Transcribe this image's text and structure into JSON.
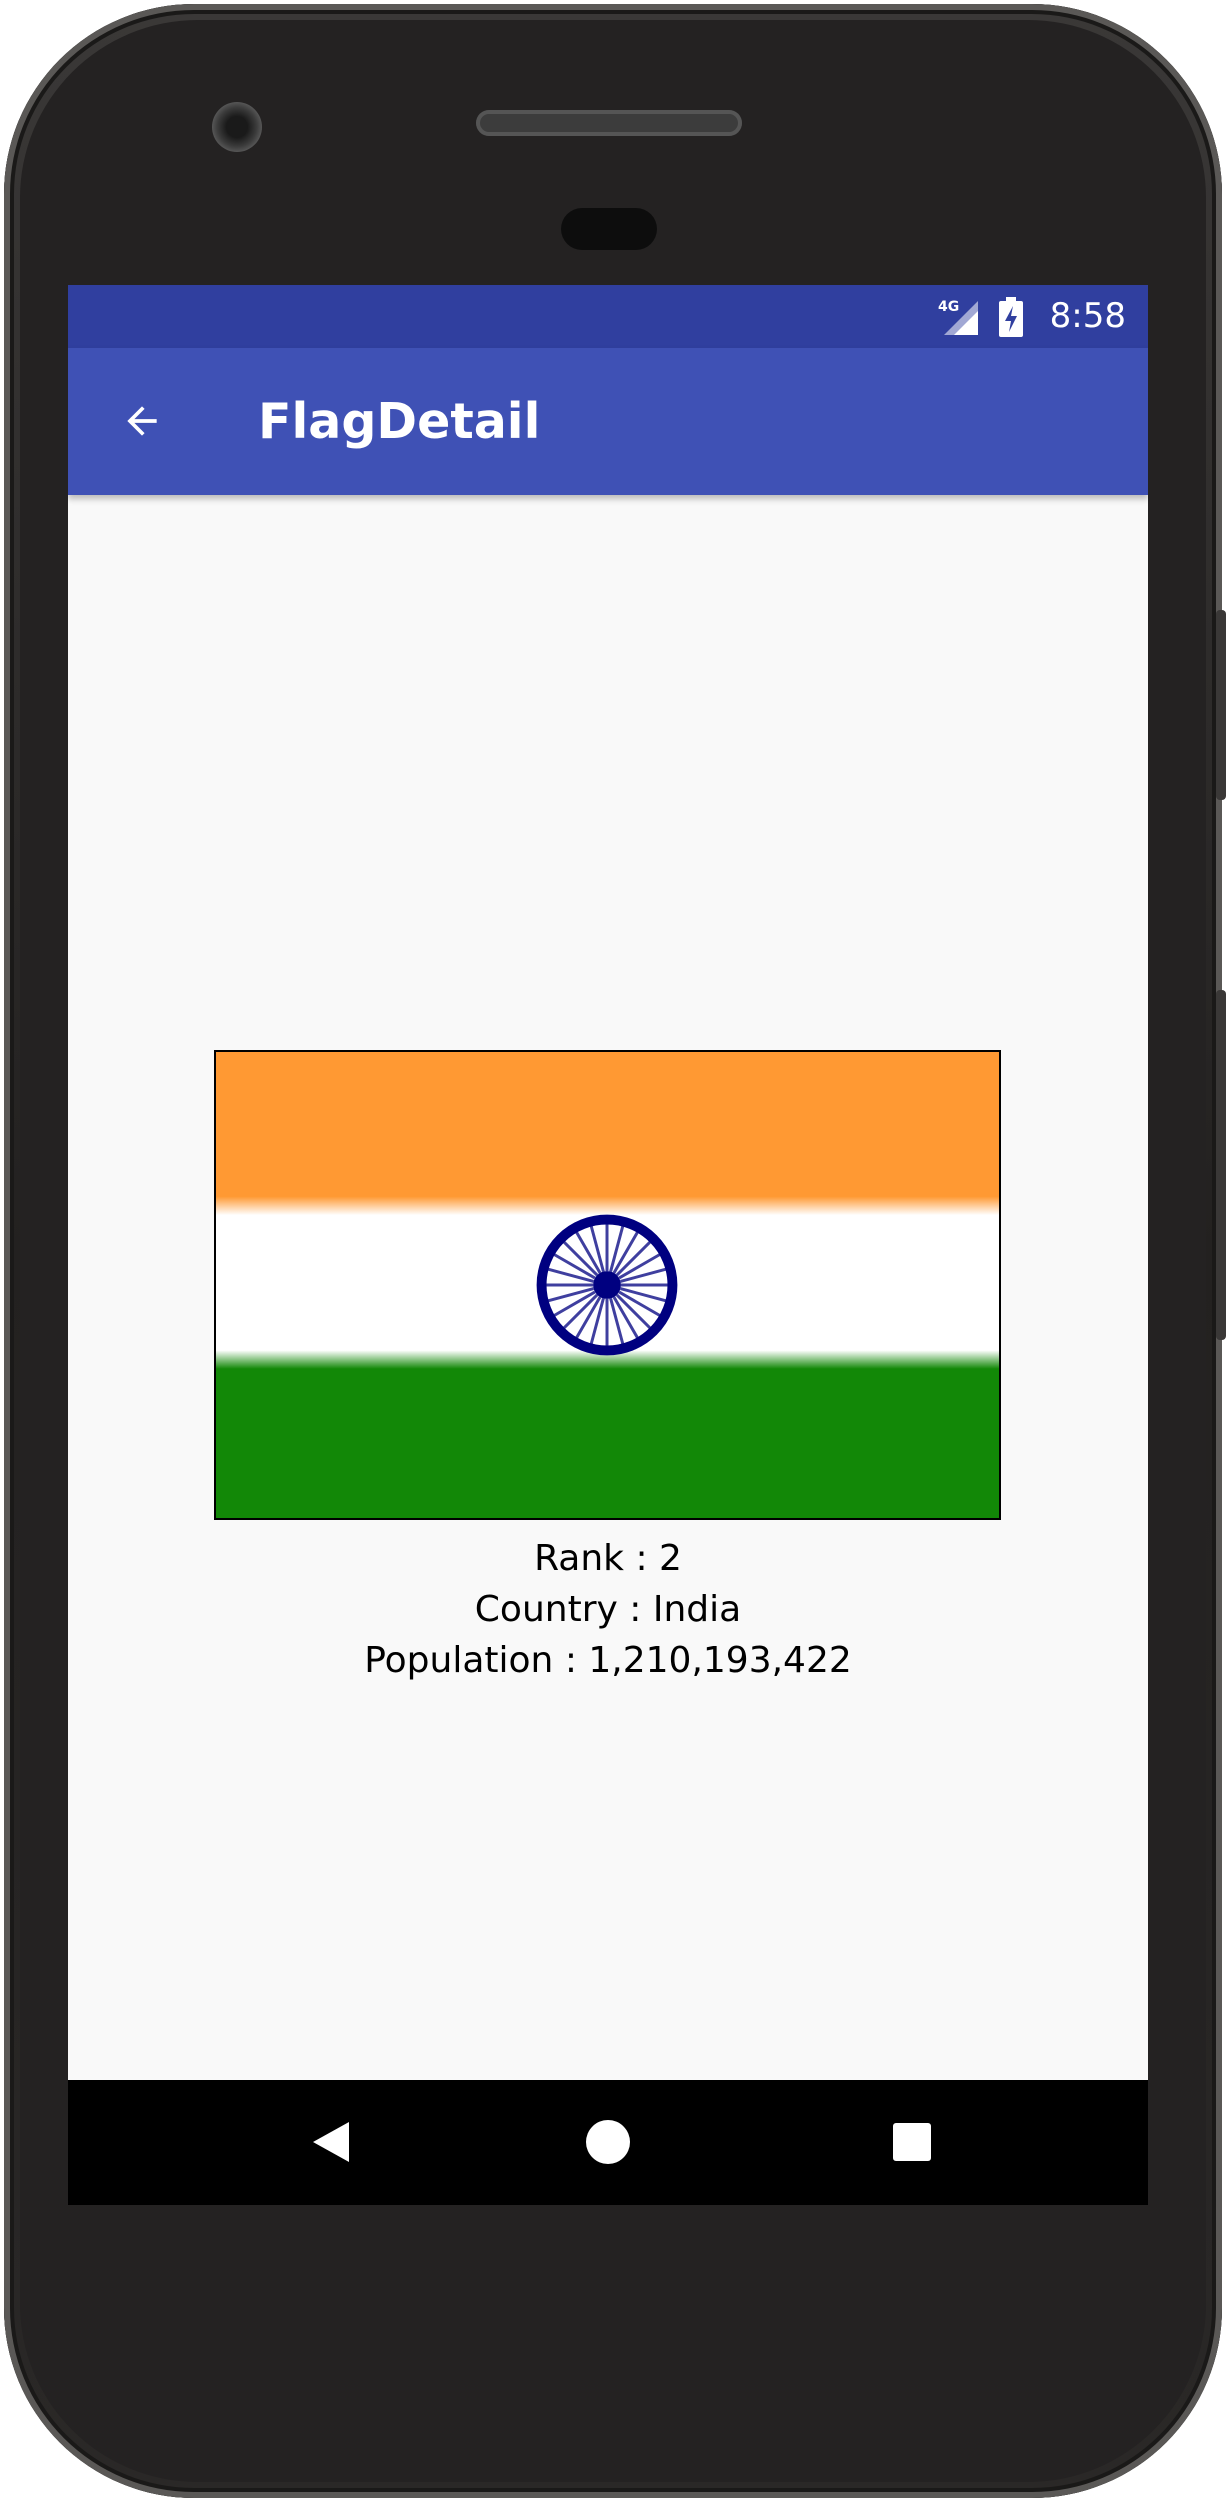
{
  "status_bar": {
    "network": "4G",
    "time": "8:58",
    "background_color": "#303f9f"
  },
  "app_bar": {
    "title": "FlagDetail",
    "back_icon": "arrow-back-icon",
    "background_color": "#3f51b5"
  },
  "flag": {
    "country": "India",
    "colors": {
      "saffron": "#ff9933",
      "white": "#ffffff",
      "green": "#128807",
      "chakra": "#000080"
    }
  },
  "details": {
    "rank": "Rank : 2",
    "country": "Country : India",
    "population": "Population : 1,210,193,422"
  },
  "navigation_bar": {
    "back_icon": "nav-back-triangle-icon",
    "home_icon": "nav-home-circle-icon",
    "recents_icon": "nav-recents-square-icon"
  }
}
